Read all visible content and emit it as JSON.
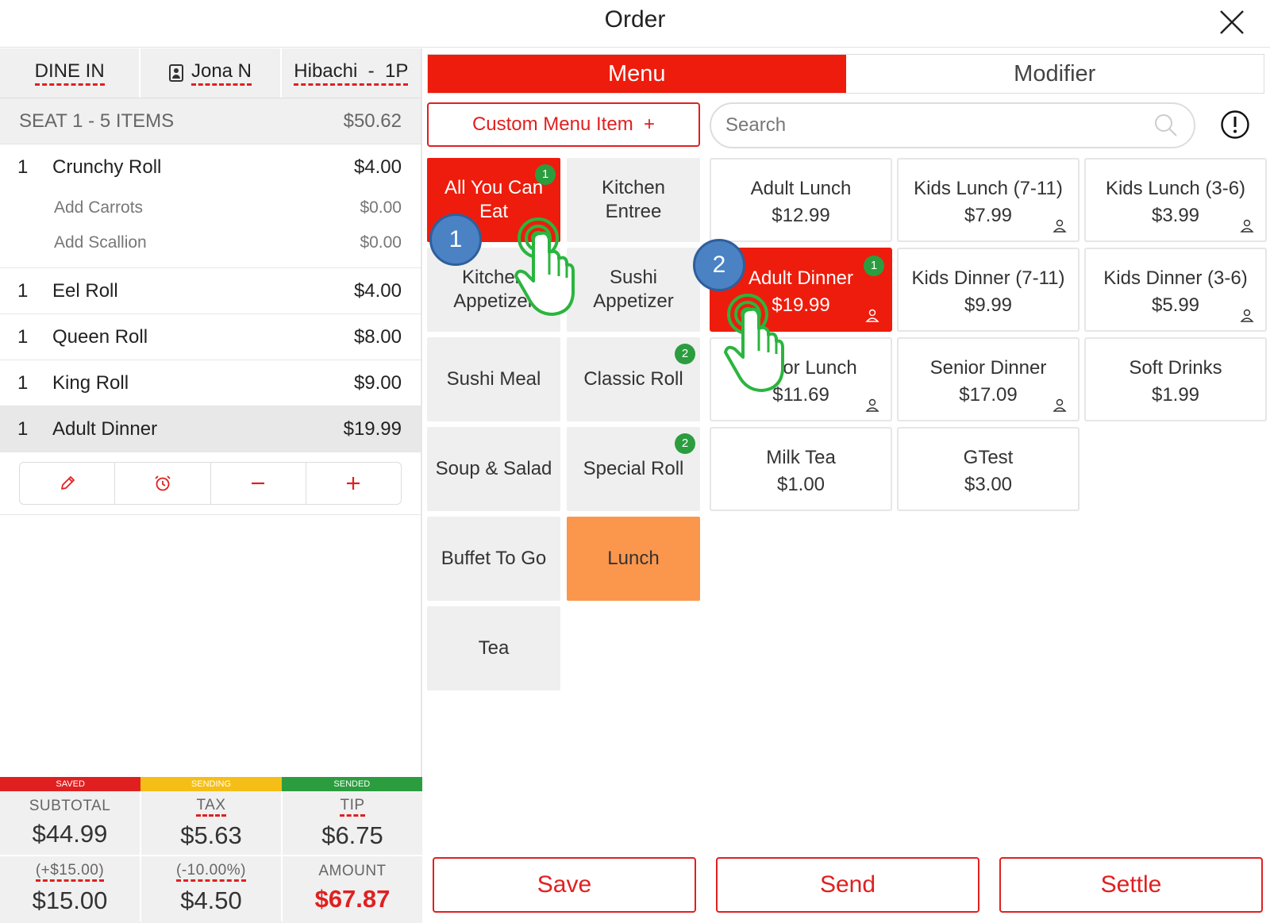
{
  "header": {
    "title": "Order"
  },
  "left": {
    "tabs": {
      "dine_in": "DINE IN",
      "server": "Jona N",
      "table": "Hibachi  -  1P"
    },
    "seat": {
      "label": "SEAT 1 - 5 ITEMS",
      "total": "$50.62"
    },
    "items": [
      {
        "qty": "1",
        "name": "Crunchy Roll",
        "price": "$4.00",
        "mods": [
          {
            "name": "Add Carrots",
            "price": "$0.00"
          },
          {
            "name": "Add Scallion",
            "price": "$0.00"
          }
        ]
      },
      {
        "qty": "1",
        "name": "Eel Roll",
        "price": "$4.00"
      },
      {
        "qty": "1",
        "name": "Queen Roll",
        "price": "$8.00"
      },
      {
        "qty": "1",
        "name": "King Roll",
        "price": "$9.00"
      },
      {
        "qty": "1",
        "name": "Adult Dinner",
        "price": "$19.99"
      }
    ],
    "status": {
      "saved": "SAVED",
      "sending": "SENDING",
      "sended": "SENDED"
    },
    "totals": {
      "subtotal_label": "SUBTOTAL",
      "subtotal": "$44.99",
      "tax_label": "TAX",
      "tax": "$5.63",
      "tip_label": "TIP",
      "tip": "$6.75",
      "extra_label": "(+$15.00)",
      "extra": "$15.00",
      "discount_label": "(-10.00%)",
      "discount": "$4.50",
      "amount_label": "AMOUNT",
      "amount": "$67.87"
    }
  },
  "tabs": {
    "menu": "Menu",
    "modifier": "Modifier"
  },
  "custom_item": "Custom Menu Item  +",
  "search": {
    "placeholder": "Search"
  },
  "categories": [
    {
      "label": "All You Can Eat",
      "badge": "1"
    },
    {
      "label": "Kitchen Entree"
    },
    {
      "label": "Kitchen Appetizer"
    },
    {
      "label": "Sushi Appetizer"
    },
    {
      "label": "Sushi Meal"
    },
    {
      "label": "Classic Roll",
      "badge": "2"
    },
    {
      "label": "Soup & Salad"
    },
    {
      "label": "Special Roll",
      "badge": "2"
    },
    {
      "label": "Buffet To Go"
    },
    {
      "label": "Lunch"
    },
    {
      "label": "Tea"
    }
  ],
  "menu_items": [
    {
      "name": "Adult Lunch",
      "price": "$12.99"
    },
    {
      "name": "Kids Lunch (7-11)",
      "price": "$7.99"
    },
    {
      "name": "Kids Lunch (3-6)",
      "price": "$3.99"
    },
    {
      "name": "Adult Dinner",
      "price": "$19.99",
      "badge": "1"
    },
    {
      "name": "Kids Dinner (7-11)",
      "price": "$9.99"
    },
    {
      "name": "Kids Dinner (3-6)",
      "price": "$5.99"
    },
    {
      "name": "Senior Lunch",
      "price": "$11.69"
    },
    {
      "name": "Senior Dinner",
      "price": "$17.09"
    },
    {
      "name": "Soft Drinks",
      "price": "$1.99"
    },
    {
      "name": "Milk Tea",
      "price": "$1.00"
    },
    {
      "name": "GTest",
      "price": "$3.00"
    }
  ],
  "steps": {
    "one": "1",
    "two": "2"
  },
  "buttons": {
    "save": "Save",
    "send": "Send",
    "settle": "Settle"
  },
  "colors": {
    "accent_red": "#ee1c0c",
    "lunch_orange": "#fb964d",
    "badge_green": "#2b9d3f",
    "step_blue": "#4a82c4",
    "status_saved": "#e02020",
    "status_sending": "#f5be17",
    "status_sended": "#2b9d3f"
  },
  "icons": {
    "close": "close-icon",
    "search": "search-icon",
    "info": "info-icon",
    "edit": "pencil-icon",
    "timer": "alarm-icon",
    "minus": "minus-icon",
    "plus": "plus-icon",
    "person": "person-icon",
    "tap": "tap-hand-icon"
  }
}
